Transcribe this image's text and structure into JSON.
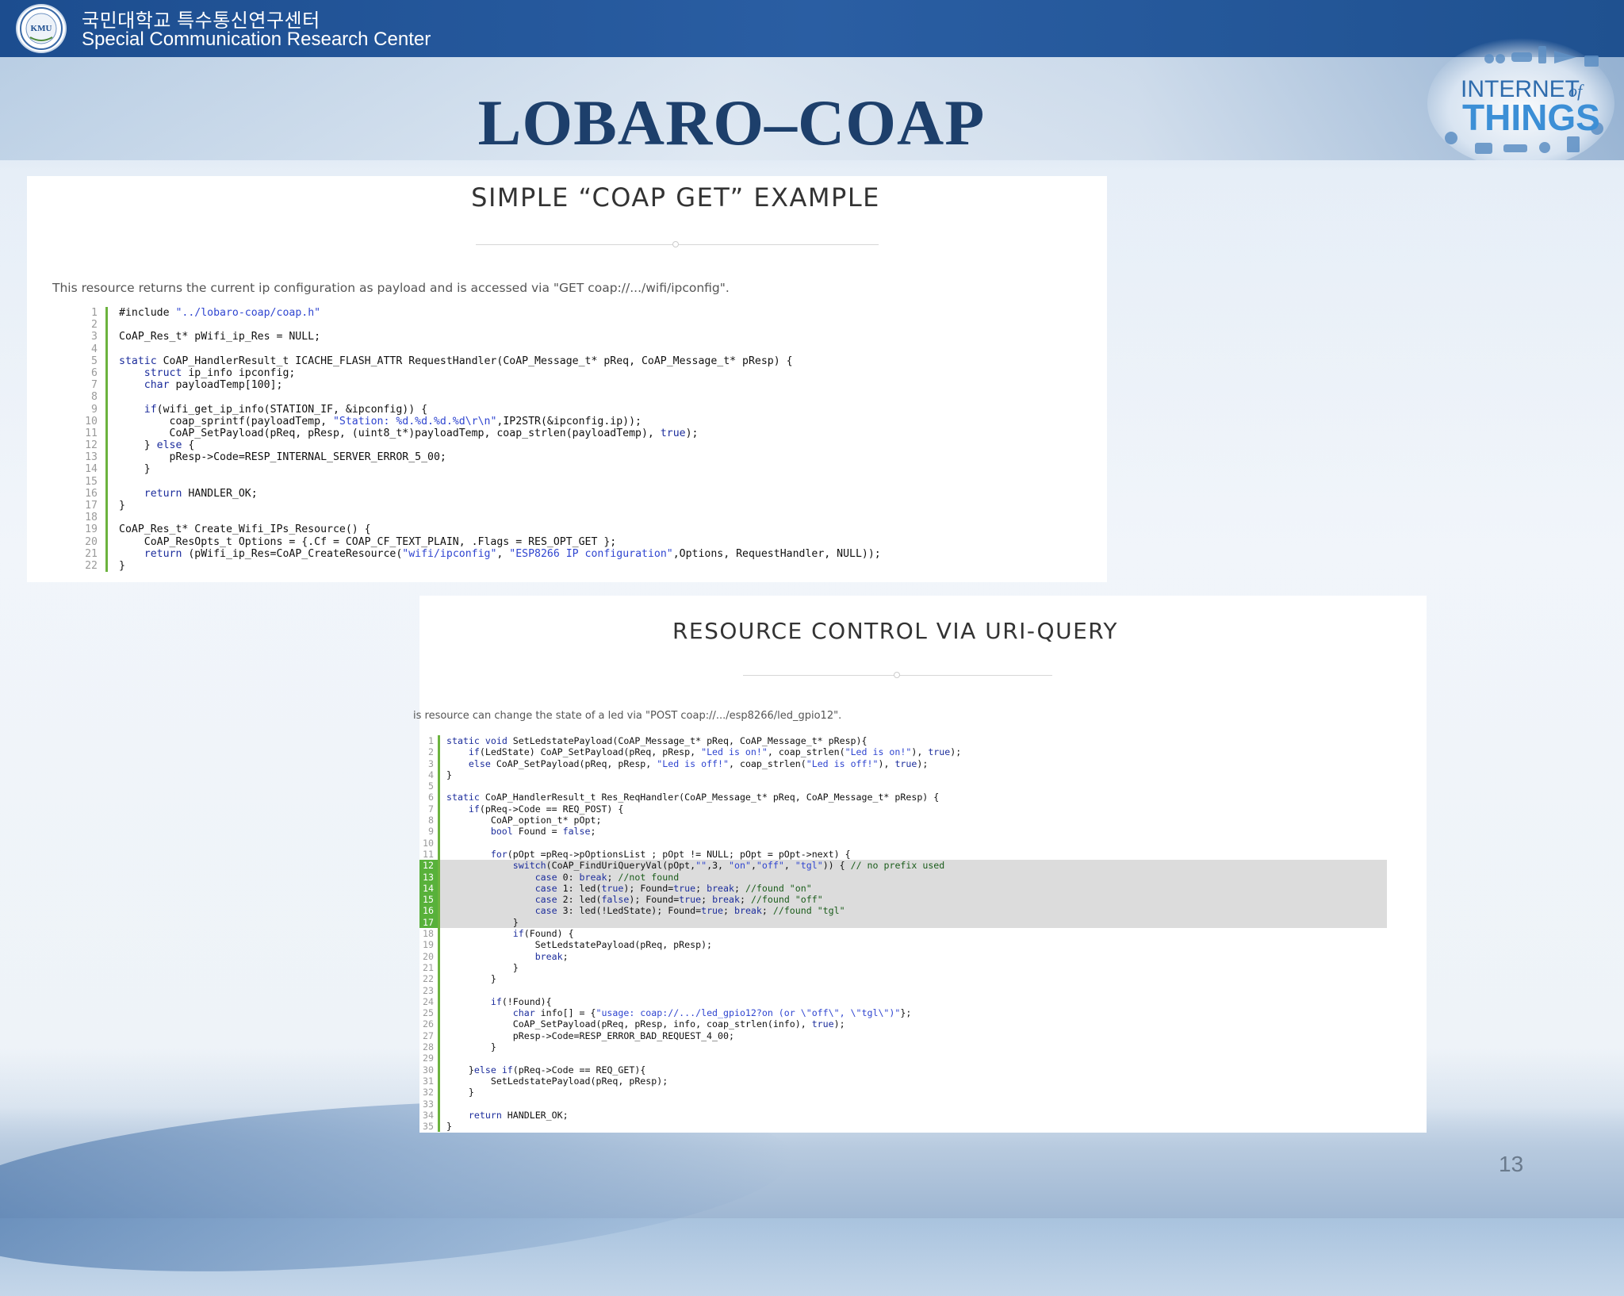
{
  "header": {
    "org_korean": "국민대학교 특수통신연구센터",
    "org_english": "Special Communication Research Center",
    "logo_text": "KMU"
  },
  "iot_logo": {
    "line1": "INTERNET",
    "of": "of",
    "line2": "THINGS"
  },
  "title": "LOBARO–COAP",
  "panel1": {
    "title": "SIMPLE “COAP GET” EXAMPLE",
    "description": "This resource returns the current ip configuration as payload and is accessed via \"GET coap://.../wifi/ipconfig\".",
    "lines": [
      "#include \"../lobaro-coap/coap.h\"",
      "",
      "CoAP_Res_t* pWifi_ip_Res = NULL;",
      "",
      "static CoAP_HandlerResult_t ICACHE_FLASH_ATTR RequestHandler(CoAP_Message_t* pReq, CoAP_Message_t* pResp) {",
      "    struct ip_info ipconfig;",
      "    char payloadTemp[100];",
      "",
      "    if(wifi_get_ip_info(STATION_IF, &ipconfig)) {",
      "        coap_sprintf(payloadTemp, \"Station: %d.%d.%d.%d\\r\\n\",IP2STR(&ipconfig.ip));",
      "        CoAP_SetPayload(pReq, pResp, (uint8_t*)payloadTemp, coap_strlen(payloadTemp), true);",
      "    } else {",
      "        pResp->Code=RESP_INTERNAL_SERVER_ERROR_5_00;",
      "    }",
      "",
      "    return HANDLER_OK;",
      "}",
      "",
      "CoAP_Res_t* Create_Wifi_IPs_Resource() {",
      "    CoAP_ResOpts_t Options = {.Cf = COAP_CF_TEXT_PLAIN, .Flags = RES_OPT_GET };",
      "    return (pWifi_ip_Res=CoAP_CreateResource(\"wifi/ipconfig\", \"ESP8266 IP configuration\",Options, RequestHandler, NULL));",
      "}"
    ]
  },
  "panel2": {
    "title": "RESOURCE CONTROL VIA URI-QUERY",
    "description": "is resource can change the state of a led via \"POST coap://.../esp8266/led_gpio12\".",
    "highlight_lines": [
      12,
      13,
      14,
      15,
      16,
      17
    ],
    "lines": [
      "static void SetLedstatePayload(CoAP_Message_t* pReq, CoAP_Message_t* pResp){",
      "    if(LedState) CoAP_SetPayload(pReq, pResp, \"Led is on!\", coap_strlen(\"Led is on!\"), true);",
      "    else CoAP_SetPayload(pReq, pResp, \"Led is off!\", coap_strlen(\"Led is off!\"), true);",
      "}",
      "",
      "static CoAP_HandlerResult_t Res_ReqHandler(CoAP_Message_t* pReq, CoAP_Message_t* pResp) {",
      "    if(pReq->Code == REQ_POST) {",
      "        CoAP_option_t* pOpt;",
      "        bool Found = false;",
      "",
      "        for(pOpt =pReq->pOptionsList ; pOpt != NULL; pOpt = pOpt->next) {",
      "            switch(CoAP_FindUriQueryVal(pOpt,\"\",3, \"on\",\"off\", \"tgl\")) { // no prefix used",
      "                case 0: break; //not found",
      "                case 1: led(true); Found=true; break; //found \"on\"",
      "                case 2: led(false); Found=true; break; //found \"off\"",
      "                case 3: led(!LedState); Found=true; break; //found \"tgl\"",
      "            }",
      "            if(Found) {",
      "                SetLedstatePayload(pReq, pResp);",
      "                break;",
      "            }",
      "        }",
      "",
      "        if(!Found){",
      "            char info[] = {\"usage: coap://.../led_gpio12?on (or \\\"off\\\", \\\"tgl\\\")\"};",
      "            CoAP_SetPayload(pReq, pResp, info, coap_strlen(info), true);",
      "            pResp->Code=RESP_ERROR_BAD_REQUEST_4_00;",
      "        }",
      "",
      "    }else if(pReq->Code == REQ_GET){",
      "        SetLedstatePayload(pReq, pResp);",
      "    }",
      "",
      "    return HANDLER_OK;",
      "}"
    ]
  },
  "page_number": "13"
}
